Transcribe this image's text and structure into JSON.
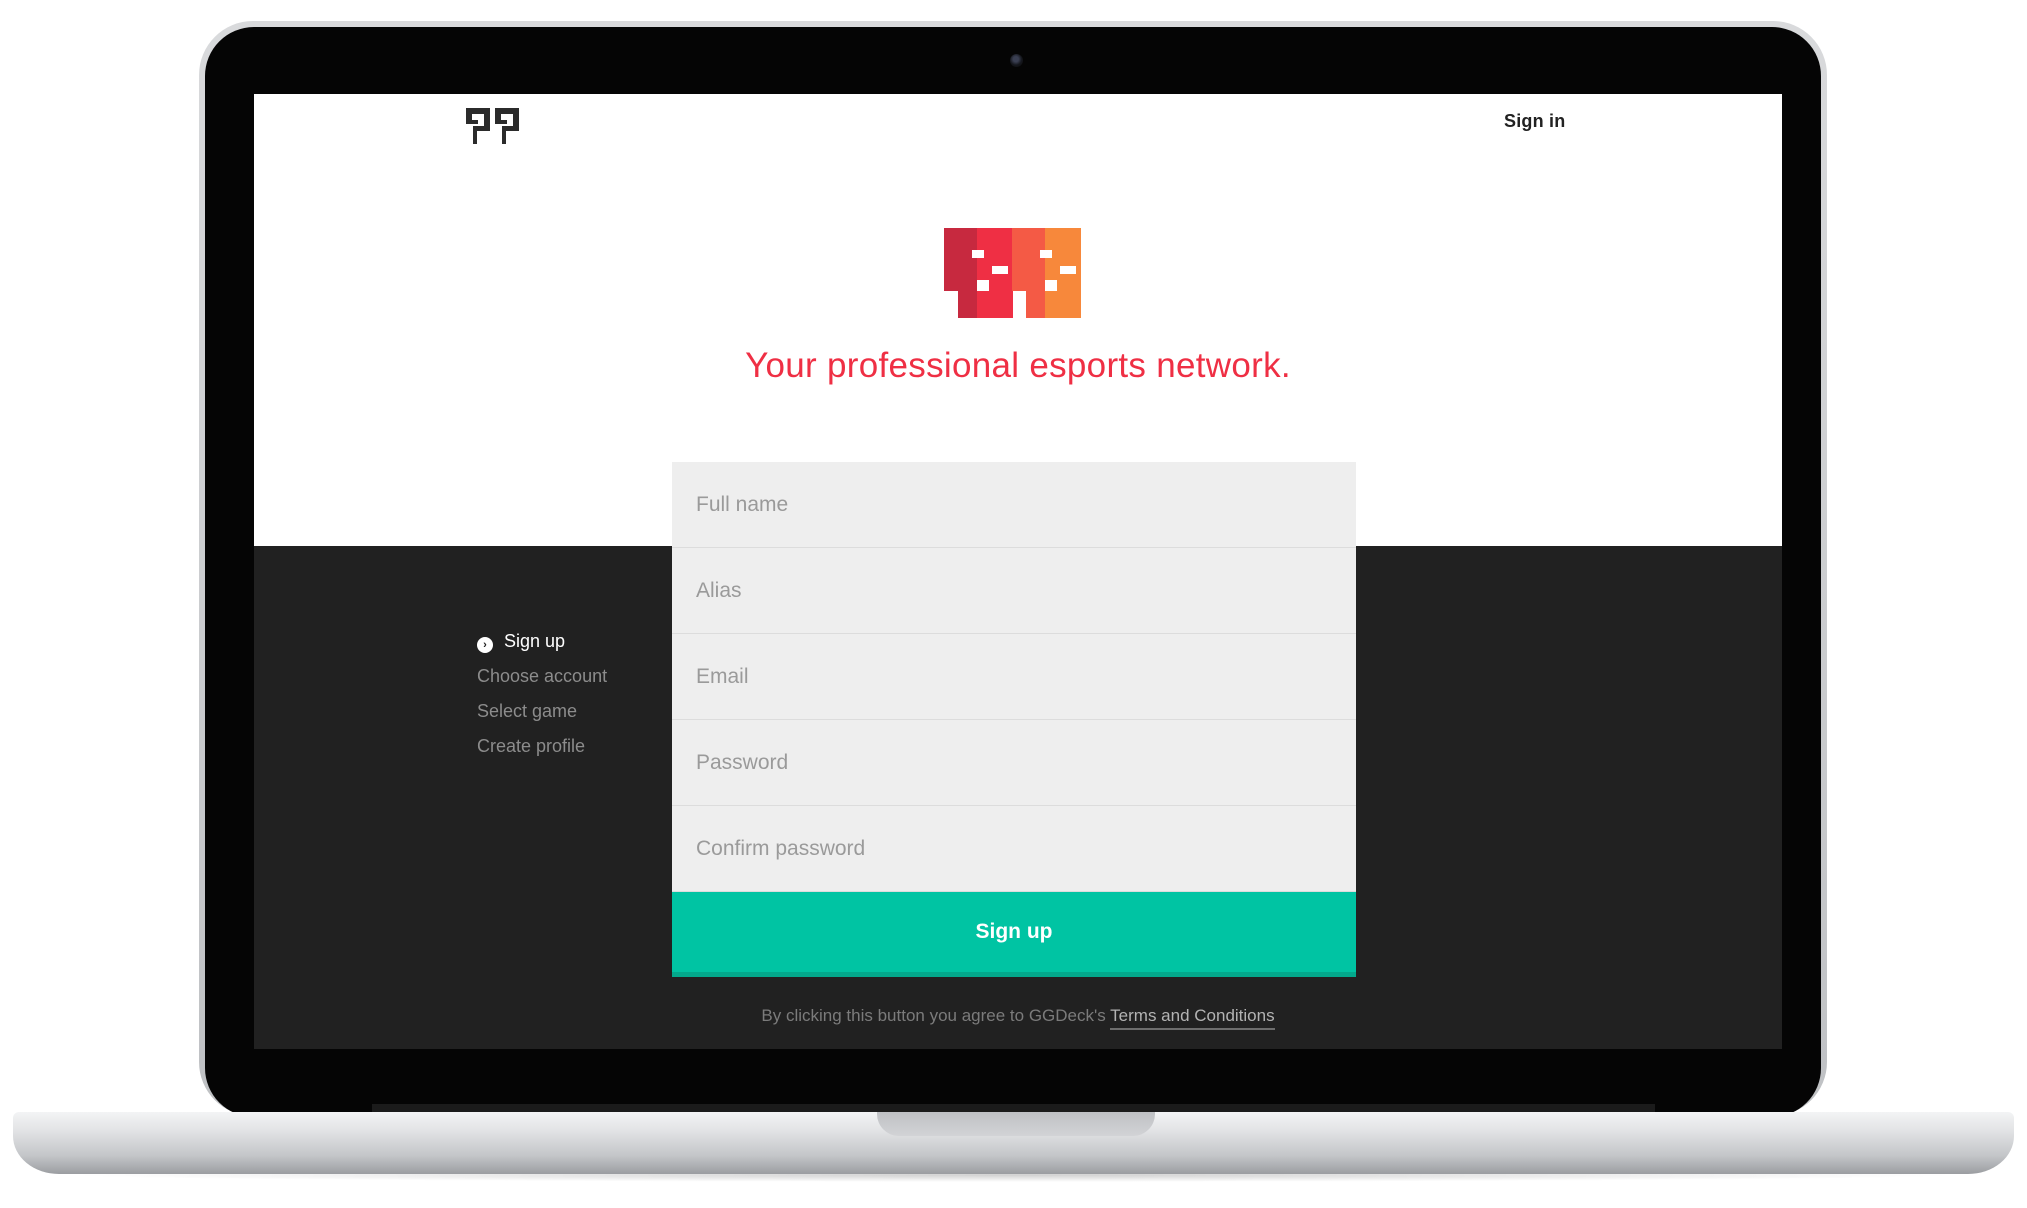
{
  "header": {
    "logo_icon": "ggdeck-logo-icon",
    "sign_in_label": "Sign in"
  },
  "hero": {
    "logo_icon": "ggdeck-color-logo-icon",
    "logo_colors": [
      "#c7293f",
      "#ef2f44",
      "#f45a45",
      "#f7883b"
    ],
    "tagline": "Your professional esports network."
  },
  "steps": {
    "active_icon": "chevron-right-circle-icon",
    "items": [
      {
        "label": "Sign up",
        "active": true
      },
      {
        "label": "Choose account",
        "active": false
      },
      {
        "label": "Select game",
        "active": false
      },
      {
        "label": "Create profile",
        "active": false
      }
    ]
  },
  "form": {
    "full_name": {
      "value": "",
      "placeholder": "Full name"
    },
    "alias": {
      "value": "",
      "placeholder": "Alias"
    },
    "email": {
      "value": "",
      "placeholder": "Email"
    },
    "password": {
      "value": "",
      "placeholder": "Password"
    },
    "confirm_password": {
      "value": "",
      "placeholder": "Confirm password"
    },
    "submit_label": "Sign up"
  },
  "legal": {
    "text": "By clicking this button you agree to GGDeck's",
    "link_label": "Terms and Conditions"
  },
  "colors": {
    "accent": "#00c4a3",
    "brand_red": "#ef2f44",
    "dark_bg": "#212121"
  }
}
